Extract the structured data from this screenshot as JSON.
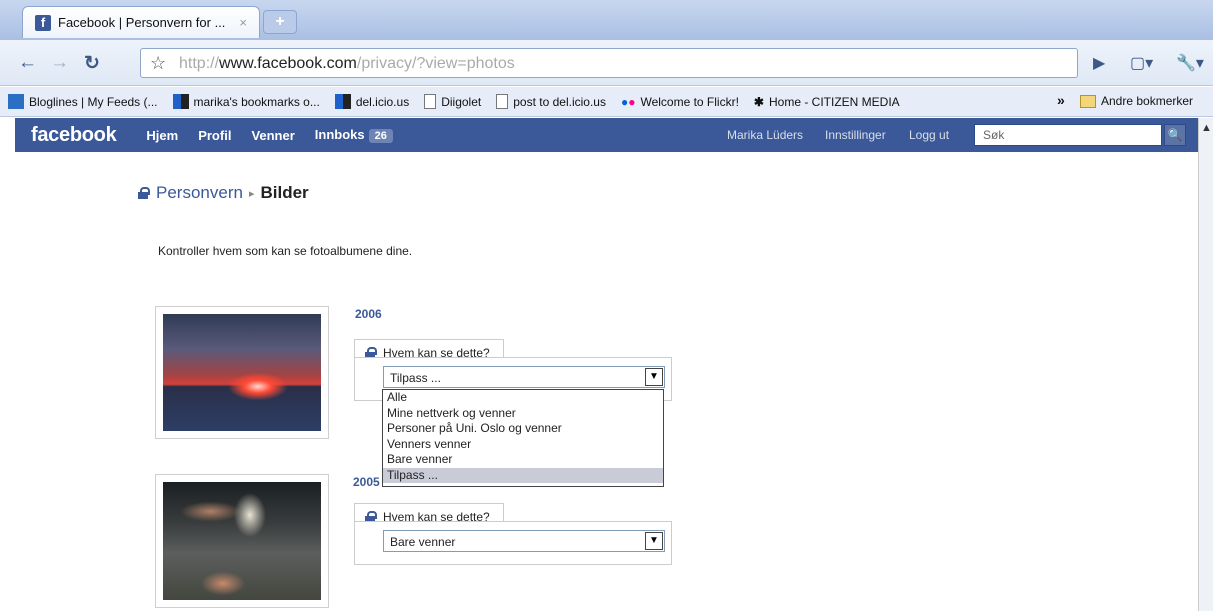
{
  "browser": {
    "tab_title": "Facebook | Personvern for ...",
    "tab_close": "×",
    "new_tab": "+",
    "url_prefix": "http://",
    "url_host": "www.facebook.com",
    "url_path": "/privacy/?view=photos"
  },
  "bookmarks": [
    {
      "label": "Bloglines | My Feeds (...",
      "icon": "bloglines-icon"
    },
    {
      "label": "marika's bookmarks o...",
      "icon": "delicious-icon"
    },
    {
      "label": "del.icio.us",
      "icon": "delicious-icon"
    },
    {
      "label": "Diigolet",
      "icon": "page-icon"
    },
    {
      "label": "post to del.icio.us",
      "icon": "page-icon"
    },
    {
      "label": "Welcome to Flickr!",
      "icon": "flickr-icon"
    },
    {
      "label": "Home - CITIZEN MEDIA",
      "icon": "citizen-media-icon"
    }
  ],
  "bookmarks_more": "»",
  "bookmarks_other": "Andre bokmerker",
  "facebook": {
    "logo": "facebook",
    "nav": [
      "Hjem",
      "Profil",
      "Venner",
      "Innboks"
    ],
    "inbox_count": "26",
    "user_name": "Marika Lüders",
    "settings": "Innstillinger",
    "logout": "Logg ut",
    "search_placeholder": "Søk"
  },
  "page": {
    "breadcrumb_parent": "Personvern",
    "breadcrumb_current": "Bilder",
    "intro": "Kontroller hvem som kan se fotoalbumene dine."
  },
  "albums": [
    {
      "year": "2006",
      "who_label": "Hvem kan se dette?",
      "selected": "Tilpass ...",
      "options": [
        "Alle",
        "Mine nettverk og venner",
        "Personer på Uni. Oslo og venner",
        "Venners venner",
        "Bare venner",
        "Tilpass ..."
      ]
    },
    {
      "year": "2005",
      "who_label": "Hvem kan se dette?",
      "selected": "Bare venner"
    }
  ],
  "colors": {
    "facebook_blue": "#3b5998",
    "link_blue": "#3b5998"
  }
}
